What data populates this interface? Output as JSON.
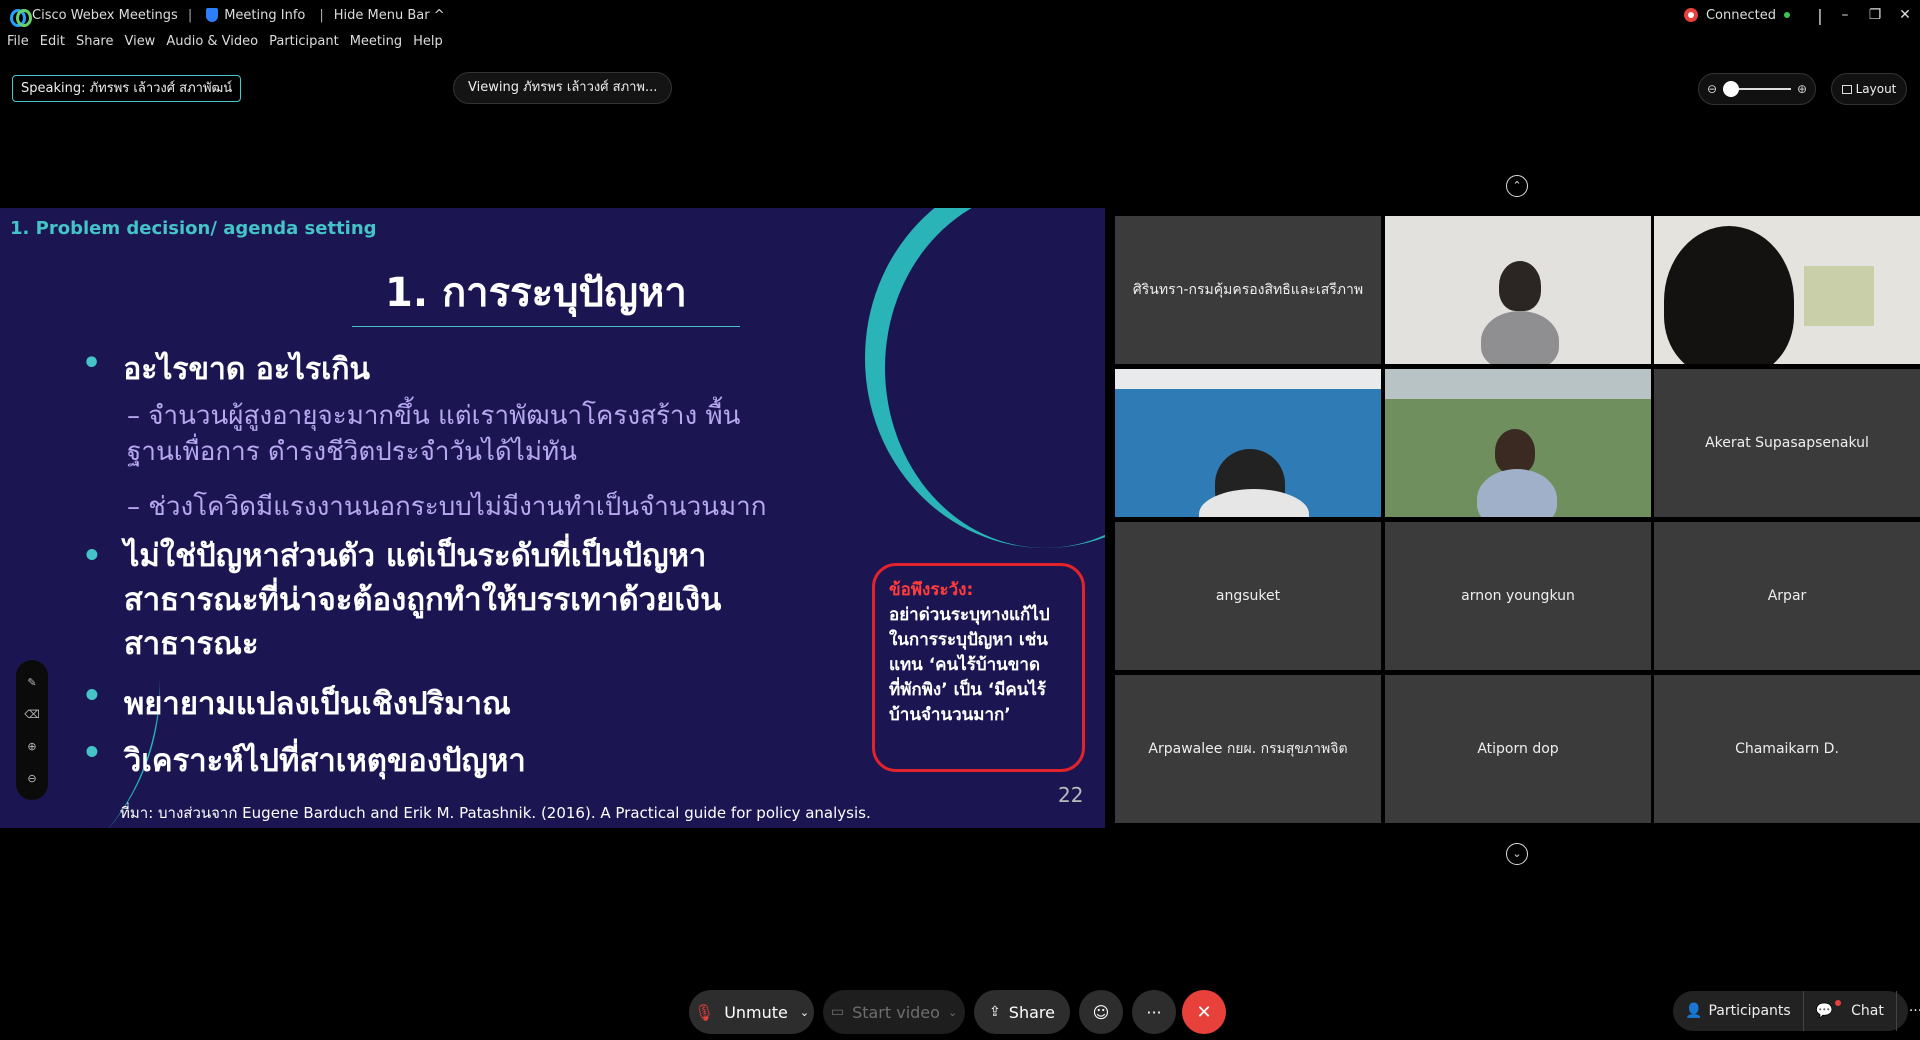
{
  "titlebar": {
    "app_name": "Cisco Webex Meetings",
    "meeting_info": "Meeting Info",
    "hide_menu": "Hide Menu Bar ^",
    "status": "Connected",
    "minimize": "–",
    "restore": "❐",
    "close": "✕"
  },
  "menu": [
    "File",
    "Edit",
    "Share",
    "View",
    "Audio & Video",
    "Participant",
    "Meeting",
    "Help"
  ],
  "speaking": "Speaking: ภัทรพร เล้าวงศ์ สภาพัฒน์",
  "viewing": "Viewing ภัทรพร เล้าวงศ์ สภาพ...",
  "layout_label": "Layout",
  "slide": {
    "tag": "1. Problem decision/ agenda setting",
    "title": "1. การระบุปัญหา",
    "bullet1": "อะไรขาด อะไรเกิน",
    "sub1": "– จำนวนผู้สูงอายุจะมากขึ้น แต่เราพัฒนาโครงสร้าง พื้นฐานเพื่อการ  ดำรงชีวิตประจำวันได้ไม่ทัน",
    "sub2": "– ช่วงโควิดมีแรงงานนอกระบบไม่มีงานทำเป็นจำนวนมาก",
    "bullet2": "ไม่ใช่ปัญหาส่วนตัว แต่เป็นระดับที่เป็นปัญหาสาธารณะที่น่าจะต้องถูกทำให้บรรเทาด้วยเงินสาธารณะ",
    "bullet3": "พยายามแปลงเป็นเชิงปริมาณ",
    "bullet4": "วิเคราะห์ไปที่สาเหตุของปัญหา",
    "warn_head": "ข้อพึงระวัง:",
    "warn_body": "อย่าด่วนระบุทางแก้ไปในการระบุปัญหา เช่น แทน ‘คนไร้บ้านขาดที่พักพิง’ เป็น ‘มีคนไร้บ้านจำนวนมาก’",
    "page": "22",
    "source": "ที่มา: บางส่วนจาก Eugene Barduch and Erik M. Patashnik. (2016). A Practical guide for policy analysis."
  },
  "participants": [
    {
      "name": "ศิรินทรา-กรมคุ้มครองสิทธิและเสรีภาพ",
      "video": false
    },
    {
      "name": "",
      "video": true
    },
    {
      "name": "",
      "video": true
    },
    {
      "name": "",
      "video": true
    },
    {
      "name": "",
      "video": true
    },
    {
      "name": "Akerat Supasapsenakul",
      "video": false
    },
    {
      "name": "angsuket",
      "video": false
    },
    {
      "name": "arnon youngkun",
      "video": false
    },
    {
      "name": "Arpar",
      "video": false
    },
    {
      "name": "Arpawalee กยผ. กรมสุขภาพจิต",
      "video": false
    },
    {
      "name": "Atiporn dop",
      "video": false
    },
    {
      "name": "Chamaikarn D.",
      "video": false
    }
  ],
  "controls": {
    "unmute": "Unmute",
    "start_video": "Start video",
    "share": "Share",
    "more": "···",
    "participants": "Participants",
    "chat": "Chat"
  }
}
